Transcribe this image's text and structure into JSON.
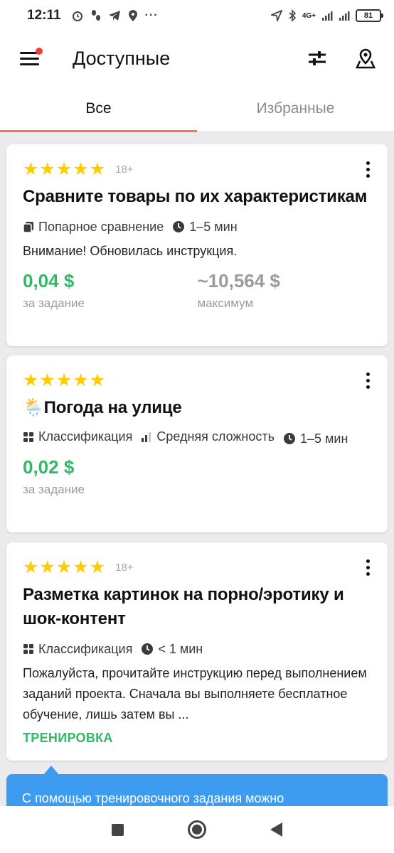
{
  "status_bar": {
    "time": "12:11",
    "network": "4G+",
    "battery": "81",
    "icons": [
      "alarm-icon",
      "steps-icon",
      "telegram-icon",
      "location-icon",
      "more-icon",
      "gps-icon",
      "bluetooth-icon",
      "signal-icon",
      "battery-icon"
    ]
  },
  "app_bar": {
    "title": "Доступные",
    "notification_dot_color": "#f03e36"
  },
  "tabs": [
    {
      "label": "Все",
      "active": true
    },
    {
      "label": "Избранные",
      "active": false
    }
  ],
  "accent_color": "#f6764a",
  "price_color": "#2fbb66",
  "cards": [
    {
      "rating": 5,
      "age": "18+",
      "title": "Сравните товары по их характеристикам",
      "meta": [
        {
          "icon": "cards-icon",
          "text": "Попарное сравнение"
        },
        {
          "icon": "clock-icon",
          "text": "1–5 мин"
        }
      ],
      "description": "Внимание! Обновилась инструкция.",
      "price": "0,04 $",
      "price_label": "за задание",
      "max_price": "~10,564 $",
      "max_label": "максимум"
    },
    {
      "rating": 5,
      "title": "🌦️Погода на улице",
      "meta": [
        {
          "icon": "grid-icon",
          "text": "Классификация"
        },
        {
          "icon": "difficulty-icon",
          "text": "Средняя сложность"
        },
        {
          "icon": "clock-icon",
          "text": "1–5 мин"
        }
      ],
      "price": "0,02 $",
      "price_label": "за задание"
    },
    {
      "rating": 5,
      "age": "18+",
      "title": "Разметка картинок на порно/эротику и шок-контент",
      "meta": [
        {
          "icon": "grid-icon",
          "text": "Классификация"
        },
        {
          "icon": "clock-icon",
          "text": "< 1 мин"
        }
      ],
      "description": "Пожалуйста, прочитайте инструкцию перед выполнением заданий проекта. Сначала вы выполняете бесплатное обучение, лишь затем вы ...",
      "badge": "ТРЕНИРОВКА"
    }
  ],
  "tooltip": {
    "text": "С помощью тренировочного задания можно"
  }
}
